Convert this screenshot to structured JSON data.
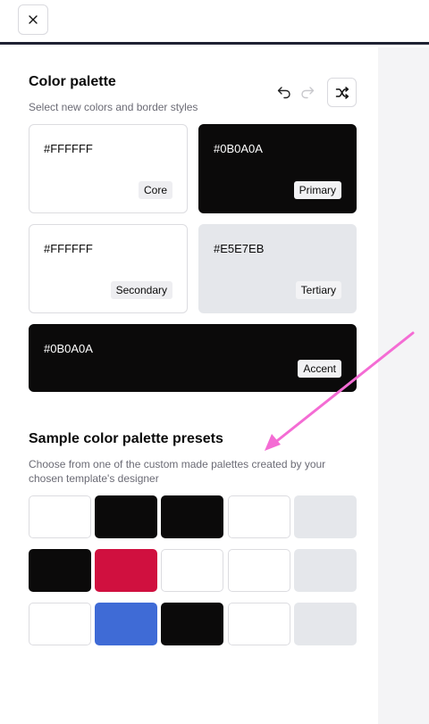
{
  "palette": {
    "title": "Color palette",
    "subtitle": "Select new colors and border styles",
    "swatches": [
      {
        "hex": "#FFFFFF",
        "label": "Core"
      },
      {
        "hex": "#0B0A0A",
        "label": "Primary"
      },
      {
        "hex": "#FFFFFF",
        "label": "Secondary"
      },
      {
        "hex": "#E5E7EB",
        "label": "Tertiary"
      },
      {
        "hex": "#0B0A0A",
        "label": "Accent"
      }
    ]
  },
  "presets": {
    "title": "Sample color palette presets",
    "subtitle_line1": "Choose from one of the custom made palettes created by your",
    "subtitle_line2": "chosen template's designer",
    "rows": [
      [
        "#FFFFFF",
        "#0B0A0A",
        "#0B0A0A",
        "#FFFFFF",
        "#E5E7EB"
      ],
      [
        "#0B0A0A",
        "#D0103F",
        "#FFFFFF",
        "#FFFFFF",
        "#E5E7EB"
      ],
      [
        "#FFFFFF",
        "#3F6BD6",
        "#0B0A0A",
        "#FFFFFF",
        "#E5E7EB"
      ]
    ]
  },
  "icons": {
    "close": "close-icon",
    "undo": "undo-icon",
    "redo": "redo-icon",
    "shuffle": "shuffle-icon"
  },
  "annotation": {
    "arrow_color": "#F46CD4"
  }
}
